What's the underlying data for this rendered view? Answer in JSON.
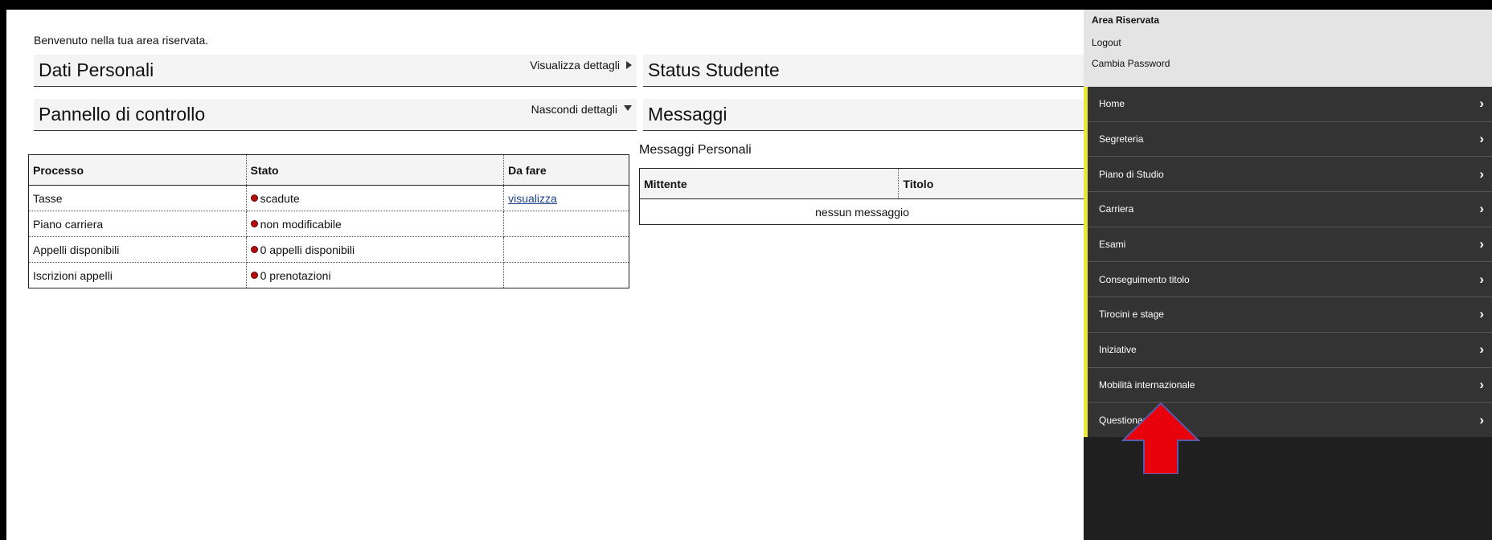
{
  "welcome": "Benvenuto nella tua area riservata.",
  "panels": {
    "dati": {
      "title": "Dati Personali",
      "toggle": "Visualizza dettagli"
    },
    "pannello": {
      "title": "Pannello di controllo",
      "toggle": "Nascondi dettagli"
    },
    "status": {
      "title": "Status Studente"
    },
    "messaggi": {
      "title": "Messaggi"
    }
  },
  "process_table": {
    "headers": [
      "Processo",
      "Stato",
      "Da fare"
    ],
    "rows": [
      {
        "processo": "Tasse",
        "stato": "scadute",
        "da_fare": "visualizza"
      },
      {
        "processo": "Piano carriera",
        "stato": "non modificabile",
        "da_fare": ""
      },
      {
        "processo": "Appelli disponibili",
        "stato": "0 appelli disponibili",
        "da_fare": ""
      },
      {
        "processo": "Iscrizioni appelli",
        "stato": "0 prenotazioni",
        "da_fare": ""
      }
    ]
  },
  "messages": {
    "section_title": "Messaggi Personali",
    "headers": [
      "Mittente",
      "Titolo"
    ],
    "empty": "nessun messaggio"
  },
  "sidebar": {
    "header": "Area Riservata",
    "links": [
      "Logout",
      "Cambia Password"
    ],
    "menu": [
      "Home",
      "Segreteria",
      "Piano di Studio",
      "Carriera",
      "Esami",
      "Conseguimento titolo",
      "Tirocini e stage",
      "Iniziative",
      "Mobilità internazionale",
      "Questionari"
    ]
  },
  "colors": {
    "sidebar_bg": "#333333",
    "accent_yellow": "#e9e935",
    "status_red": "#b01010",
    "arrow_red": "#e8000b"
  },
  "icons": {
    "menu_chevron": "chevron-right-icon",
    "status_dot": "red-dot-icon",
    "annotation_arrow": "red-up-arrow"
  }
}
